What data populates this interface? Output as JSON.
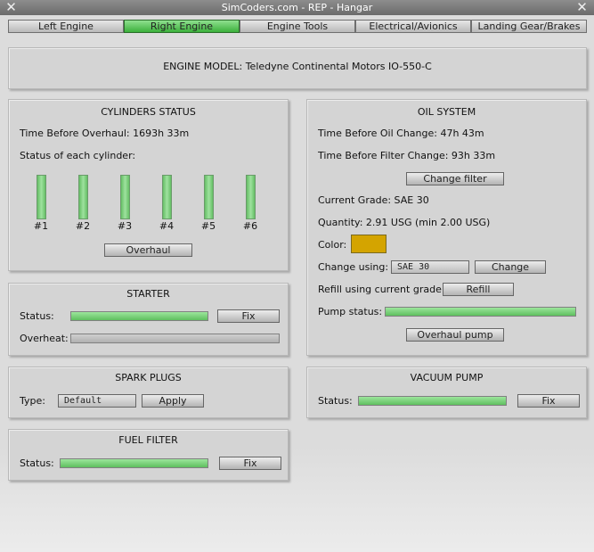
{
  "window": {
    "title": "SimCoders.com - REP - Hangar"
  },
  "tabs": [
    {
      "label": "Left Engine"
    },
    {
      "label": "Right Engine"
    },
    {
      "label": "Engine Tools"
    },
    {
      "label": "Electrical/Avionics"
    },
    {
      "label": "Landing Gear/Brakes"
    }
  ],
  "engine_model": "ENGINE MODEL: Teledyne Continental Motors IO-550-C",
  "cylinders": {
    "title": "CYLINDERS STATUS",
    "tbo_label": "Time Before Overhaul: 1693h 33m",
    "status_label": "Status of each cylinder:",
    "items": [
      "#1",
      "#2",
      "#3",
      "#4",
      "#5",
      "#6"
    ],
    "overhaul_button": "Overhaul"
  },
  "starter": {
    "title": "STARTER",
    "status_label": "Status:",
    "status_level": 1.0,
    "overheat_label": "Overheat:",
    "overheat_level": 0.0,
    "fix_button": "Fix"
  },
  "spark_plugs": {
    "title": "SPARK PLUGS",
    "type_label": "Type:",
    "type_value": "Default",
    "apply_button": "Apply"
  },
  "fuel_filter": {
    "title": "FUEL FILTER",
    "status_label": "Status:",
    "status_level": 1.0,
    "fix_button": "Fix"
  },
  "oil": {
    "title": "OIL SYSTEM",
    "oil_change_label": "Time Before Oil Change: 47h 43m",
    "filter_change_label": "Time Before Filter Change: 93h 33m",
    "change_filter_button": "Change filter",
    "grade_label": "Current Grade: SAE 30",
    "quantity_label": "Quantity: 2.91 USG (min 2.00 USG)",
    "color_label": "Color:",
    "color": "#d4a400",
    "change_using_label": "Change using:",
    "change_using_value": "SAE 30",
    "change_button": "Change",
    "refill_label": "Refill using current grade:",
    "refill_button": "Refill",
    "pump_label": "Pump status:",
    "pump_level": 1.0,
    "overhaul_pump_button": "Overhaul pump"
  },
  "vacuum": {
    "title": "VACUUM PUMP",
    "status_label": "Status:",
    "status_level": 1.0,
    "fix_button": "Fix"
  },
  "colors": {
    "active_tab": "#3bb03b",
    "bar_fill": "#7fd27f"
  }
}
